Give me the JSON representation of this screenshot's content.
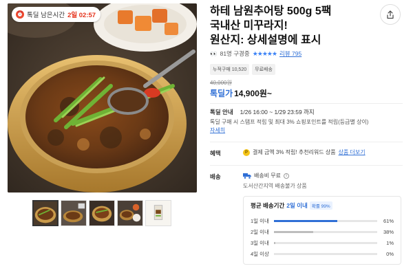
{
  "timer": {
    "label": "톡딜 남은시간",
    "time": "2일 02:57"
  },
  "product": {
    "title_line1": "하테 남원추어탕 500g 5팩",
    "title_line2": "국내산 미꾸라지!",
    "title_line3": "원산지: 상세설명에 표시"
  },
  "reviews": {
    "emoji": "👀",
    "viewers": "81명 구경중",
    "stars": "★★★★★",
    "review_link": "리뷰 795"
  },
  "tags": [
    "누적구매 10,520",
    "무료배송"
  ],
  "price": {
    "original": "40,000원",
    "label": "톡딜가",
    "value": "14,900원~"
  },
  "deal": {
    "label": "톡딜 안내",
    "period": "1/26 16:00 ~ 1/29 23:59 까지",
    "desc": "톡딜 구매 시 스탬프 적립 및 최대 3% 쇼핑포인트를 적립(등급별 상이)",
    "more_link": "자세히"
  },
  "benefit": {
    "label": "혜택",
    "text": "결제 금액 3% 적립! 추천리워드 상품",
    "link": "상품 더보기"
  },
  "shipping": {
    "label": "배송",
    "fee": "배송비 무료",
    "note": "도서산간지역 배송불가 상품"
  },
  "delivery": {
    "title": "평균 배송기간",
    "highlight": "2일 이내",
    "badge": "확률 99%",
    "rows": [
      {
        "label": "1일 이내",
        "pct": "61%",
        "value": 0.61,
        "color": "#2f6fd6"
      },
      {
        "label": "2일 이내",
        "pct": "38%",
        "value": 0.38,
        "color": "#bdbdbd"
      },
      {
        "label": "3일 이내",
        "pct": "1%",
        "value": 0.01,
        "color": "#bdbdbd"
      },
      {
        "label": "4일 이상",
        "pct": "0%",
        "value": 0.0,
        "color": "#bdbdbd"
      }
    ]
  },
  "icons": {
    "share": "share-icon",
    "timer": "alarm-icon",
    "coin": "coin-icon",
    "truck": "truck-icon",
    "info": "info-icon"
  }
}
